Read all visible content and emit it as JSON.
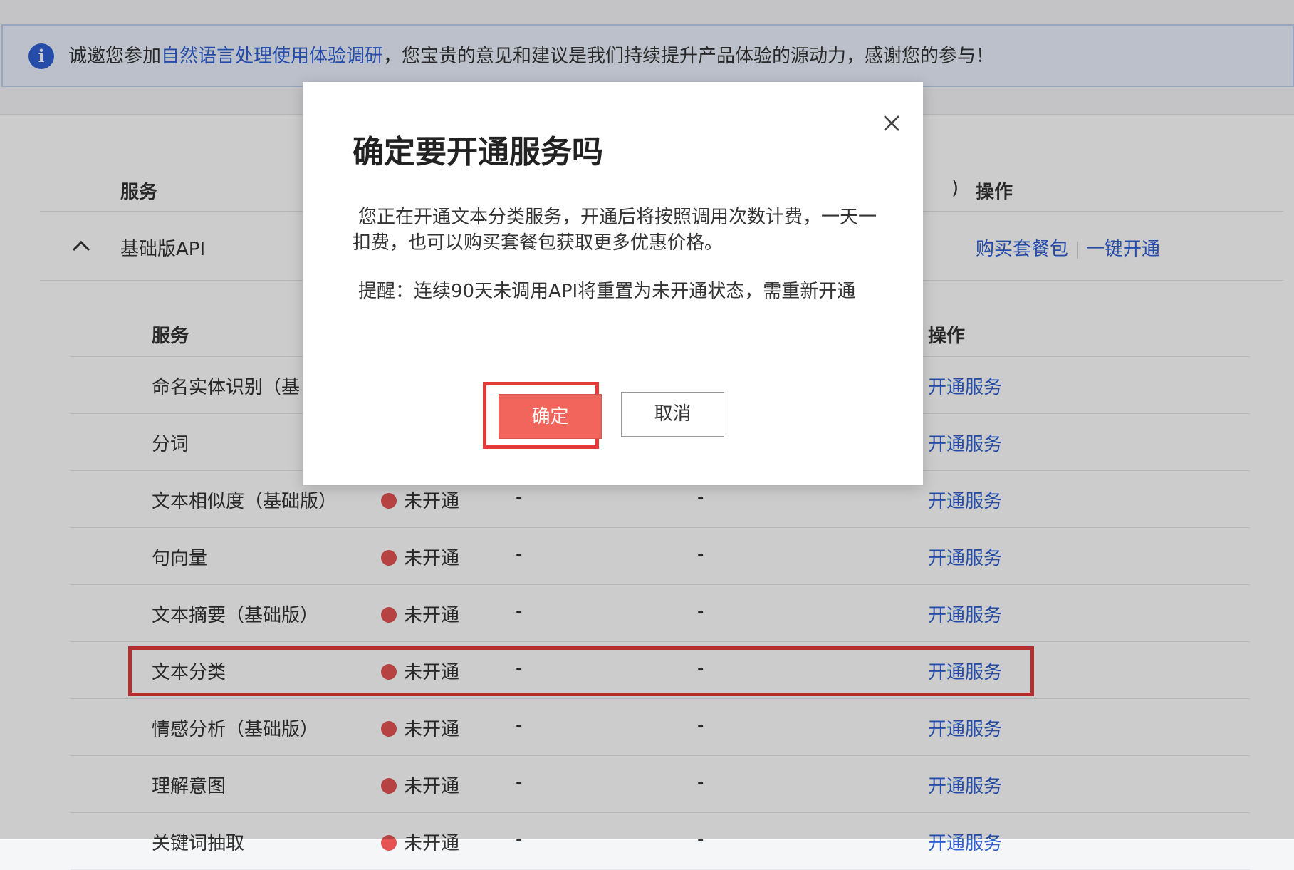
{
  "notice": {
    "prefix": "诚邀您参加",
    "link": "自然语言处理使用体验调研",
    "suffix": "，您宝贵的意见和建议是我们持续提升产品体验的源动力，感谢您的参与！"
  },
  "top_table": {
    "col_service": "服务",
    "col_paren": ")",
    "col_op": "操作",
    "group_title": "基础版API",
    "op_buy": "购买套餐包",
    "op_enable_all": "一键开通"
  },
  "sub_table": {
    "col_service": "服务",
    "col_op": "操作",
    "rows": [
      {
        "name": "命名实体识别（基",
        "status": "",
        "dash1": "",
        "dash2": "",
        "op": "开通服务"
      },
      {
        "name": "分词",
        "status": "",
        "dash1": "",
        "dash2": "",
        "op": "开通服务"
      },
      {
        "name": "文本相似度（基础版）",
        "status": "未开通",
        "dash1": "-",
        "dash2": "-",
        "op": "开通服务"
      },
      {
        "name": "句向量",
        "status": "未开通",
        "dash1": "-",
        "dash2": "-",
        "op": "开通服务"
      },
      {
        "name": "文本摘要（基础版）",
        "status": "未开通",
        "dash1": "-",
        "dash2": "-",
        "op": "开通服务"
      },
      {
        "name": "文本分类",
        "status": "未开通",
        "dash1": "-",
        "dash2": "-",
        "op": "开通服务"
      },
      {
        "name": "情感分析（基础版）",
        "status": "未开通",
        "dash1": "-",
        "dash2": "-",
        "op": "开通服务"
      },
      {
        "name": "理解意图",
        "status": "未开通",
        "dash1": "-",
        "dash2": "-",
        "op": "开通服务"
      },
      {
        "name": "关键词抽取",
        "status": "未开通",
        "dash1": "-",
        "dash2": "-",
        "op": "开通服务"
      }
    ]
  },
  "modal": {
    "title": "确定要开通服务吗",
    "body_para1": "您正在开通文本分类服务，开通后将按照调用次数计费，一天一扣费，也可以购买套餐包获取更多优惠价格。",
    "body_para2": "提醒：连续90天未调用API将重置为未开通状态，需重新开通",
    "confirm_label": "确定",
    "cancel_label": "取消"
  },
  "colors": {
    "link": "#2f5fd2",
    "status_dot": "#e55353",
    "confirm_button": "#f2655d",
    "highlight_border": "#e33a3a"
  }
}
